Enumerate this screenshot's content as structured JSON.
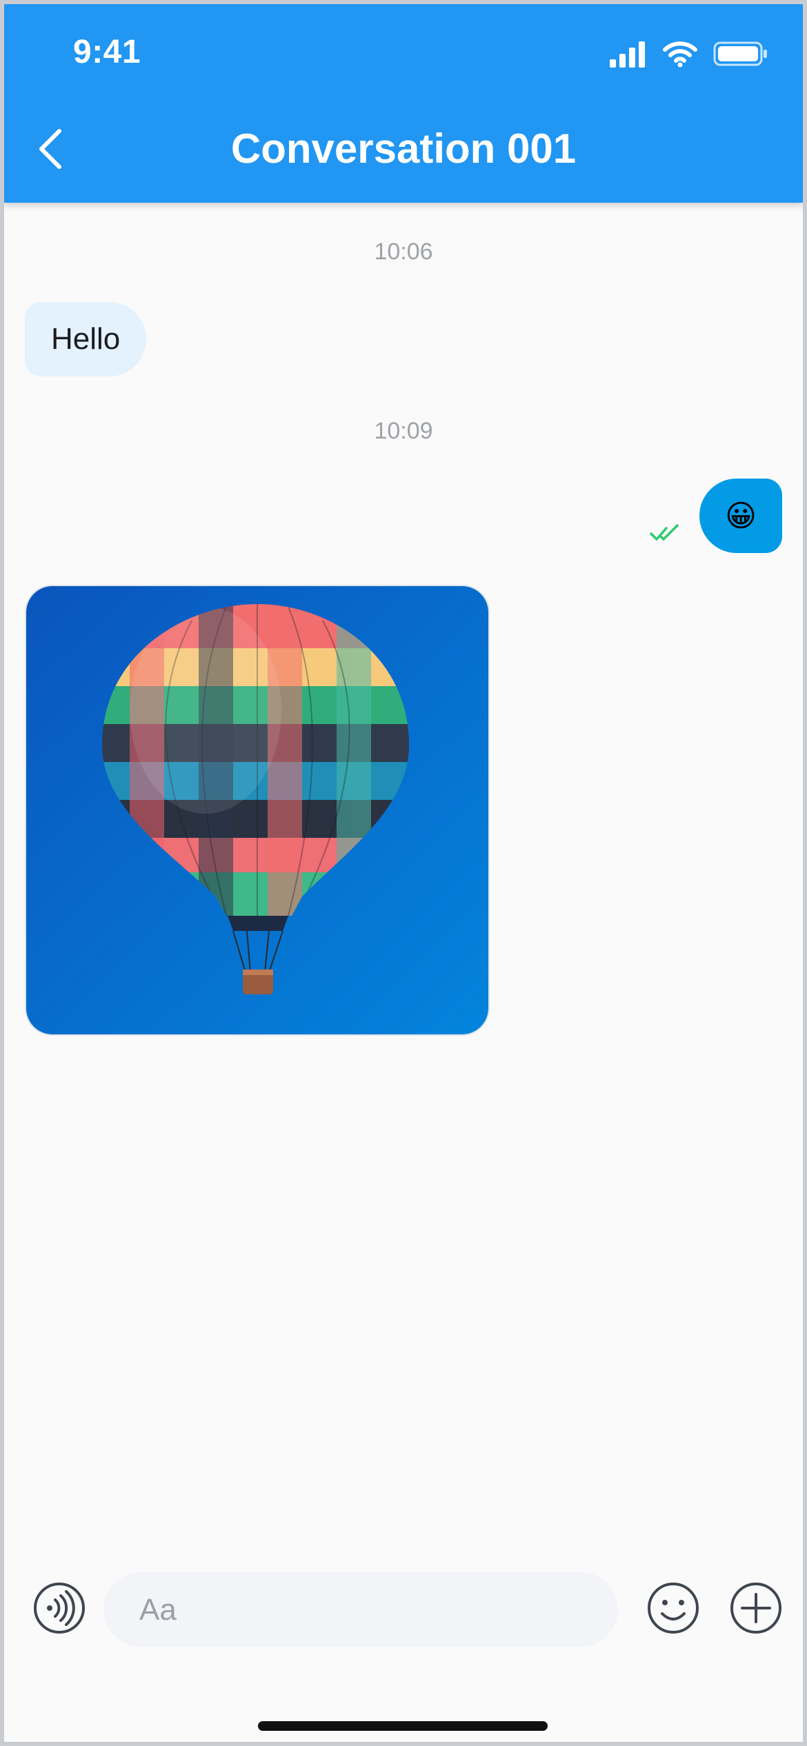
{
  "status_bar": {
    "time": "9:41"
  },
  "header": {
    "title": "Conversation 001"
  },
  "messages": [
    {
      "type": "timestamp",
      "text": "10:06"
    },
    {
      "type": "text",
      "direction": "incoming",
      "text": "Hello"
    },
    {
      "type": "timestamp",
      "text": "10:09"
    },
    {
      "type": "emoji",
      "direction": "outgoing",
      "text": "😀",
      "status": "read"
    },
    {
      "type": "image",
      "direction": "incoming",
      "subject": "hot-air-balloon"
    }
  ],
  "composer": {
    "placeholder": "Aa"
  },
  "colors": {
    "header": "#2196f3",
    "incoming_bubble": "#e3f2fd",
    "outgoing_bubble": "#039be5",
    "read_check": "#2ecc71",
    "background": "#fafafa"
  }
}
